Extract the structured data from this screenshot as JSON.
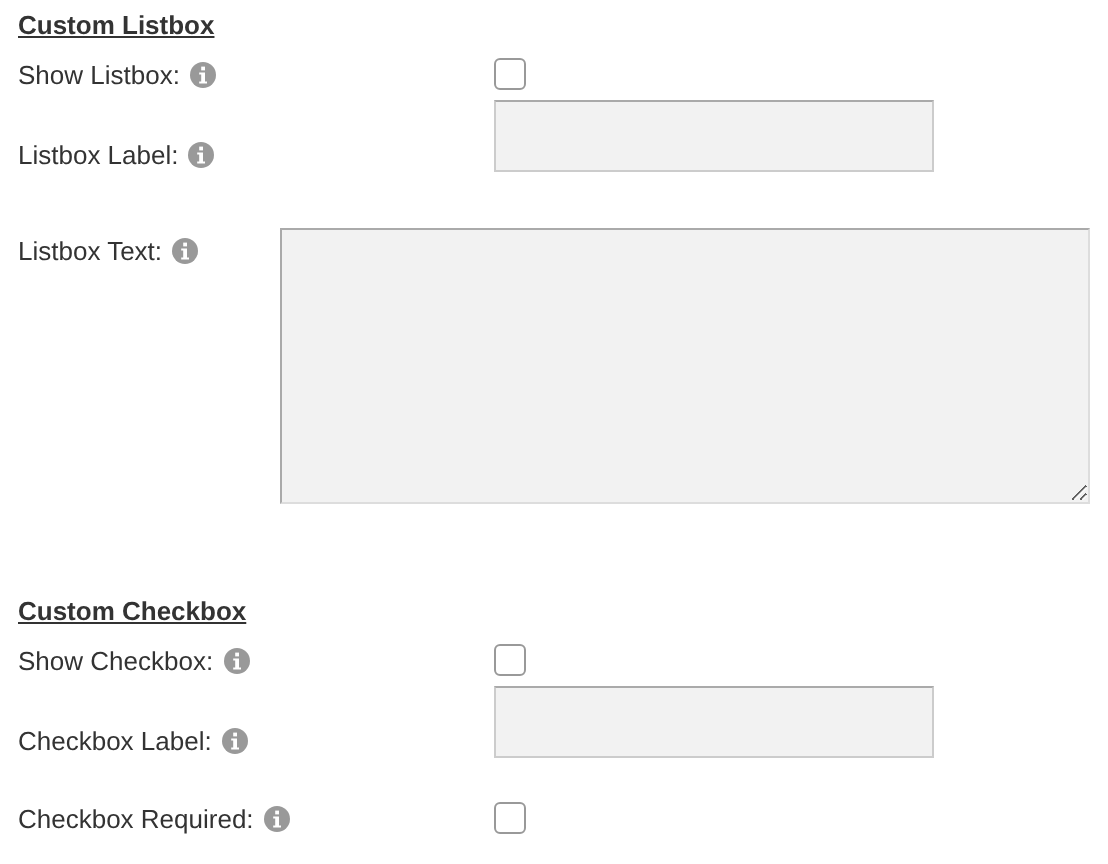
{
  "sections": [
    {
      "title": "Custom Listbox",
      "fields": [
        {
          "kind": "checkbox",
          "label": "Show Listbox:",
          "checked": false
        },
        {
          "kind": "text",
          "label": "Listbox Label:"
        },
        {
          "kind": "textarea",
          "label": "Listbox Text:"
        }
      ]
    },
    {
      "title": "Custom Checkbox",
      "fields": [
        {
          "kind": "checkbox",
          "label": "Show Checkbox:",
          "checked": false
        },
        {
          "kind": "text",
          "label": "Checkbox Label:"
        },
        {
          "kind": "checkbox",
          "label": "Checkbox Required:",
          "checked": false
        }
      ]
    }
  ]
}
